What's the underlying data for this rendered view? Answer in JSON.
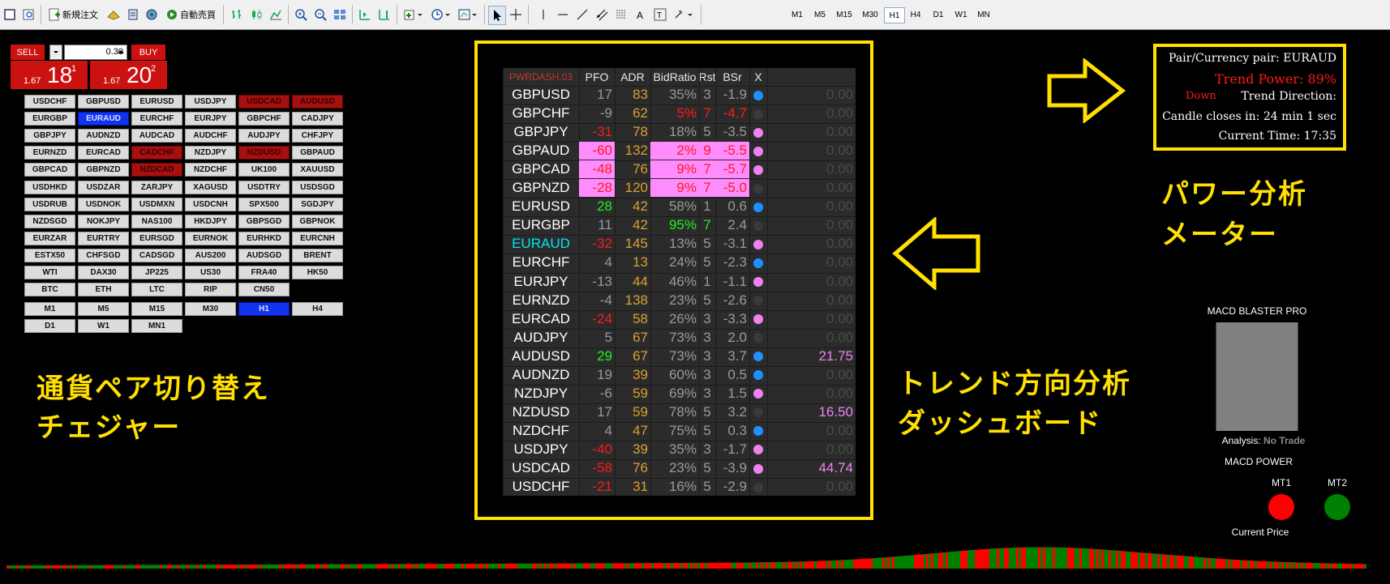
{
  "toolbar": {
    "new_order": "新規注文",
    "auto_trade": "自動売買",
    "timeframes": [
      "M1",
      "M5",
      "M15",
      "M30",
      "H1",
      "H4",
      "D1",
      "W1",
      "MN"
    ],
    "selected_timeframe": "H1"
  },
  "trade_panel": {
    "sell_label": "SELL",
    "buy_label": "BUY",
    "lot_value": "0.30",
    "sell_price": {
      "prefix": "1.67",
      "big": "18",
      "sup": "1"
    },
    "buy_price": {
      "prefix": "1.67",
      "big": "20",
      "sup": "2"
    }
  },
  "pair_switcher": {
    "pairs": [
      [
        "USDCHF",
        "GBPUSD",
        "EURUSD",
        "USDJPY",
        "USDCAD",
        "AUDUSD"
      ],
      [
        "EURGBP",
        "EURAUD",
        "EURCHF",
        "EURJPY",
        "GBPCHF",
        "CADJPY"
      ],
      [
        "GBPJPY",
        "AUDNZD",
        "AUDCAD",
        "AUDCHF",
        "AUDJPY",
        "CHFJPY"
      ],
      [
        "EURNZD",
        "EURCAD",
        "CADCHF",
        "NZDJPY",
        "NZDUSD",
        "GBPAUD"
      ],
      [
        "GBPCAD",
        "GBPNZD",
        "NZDCAD",
        "NZDCHF",
        "UK100",
        "XAUUSD"
      ],
      [
        "USDHKD",
        "USDZAR",
        "ZARJPY",
        "XAGUSD",
        "USDTRY",
        "USDSGD"
      ],
      [
        "USDRUB",
        "USDNOK",
        "USDMXN",
        "USDCNH",
        "SPX500",
        "SGDJPY"
      ],
      [
        "NZDSGD",
        "NOKJPY",
        "NAS100",
        "HKDJPY",
        "GBPSGD",
        "GBPNOK"
      ],
      [
        "EURZAR",
        "EURTRY",
        "EURSGD",
        "EURNOK",
        "EURHKD",
        "EURCNH"
      ],
      [
        "ESTX50",
        "CHFSGD",
        "CADSGD",
        "AUS200",
        "AUDSGD",
        "BRENT"
      ],
      [
        "WTI",
        "DAX30",
        "JP225",
        "US30",
        "FRA40",
        "HK50"
      ],
      [
        "BTC",
        "ETH",
        "LTC",
        "RIP",
        "CN50"
      ]
    ],
    "highlight_red": [
      "USDCAD",
      "AUDUSD",
      "CADCHF",
      "NZDUSD",
      "NZDCAD"
    ],
    "selected_pair": "EURAUD",
    "timeframes": [
      [
        "M1",
        "M5",
        "M15",
        "M30",
        "H1",
        "H4"
      ],
      [
        "D1",
        "W1",
        "MN1"
      ]
    ],
    "selected_timeframe": "H1"
  },
  "labels": {
    "switcher_line1": "通貨ペア切り替え",
    "switcher_line2": "チェジャー",
    "dashboard_line1": "トレンド方向分析",
    "dashboard_line2": "ダッシュボード",
    "meter_line1": "パワー分析",
    "meter_line2": "メーター"
  },
  "dashboard": {
    "headers": [
      "PWRDASH.03",
      "PFO",
      "ADR",
      "BidRatio",
      "Rst",
      "BSr",
      "X"
    ],
    "rows": [
      {
        "pair": "GBPUSD",
        "pfo": "17",
        "adr": "83",
        "bid": "35%",
        "rst": "3",
        "bsr": "-1.9",
        "dot": "blue",
        "val": "0.00"
      },
      {
        "pair": "GBPCHF",
        "pfo": "-9",
        "adr": "62",
        "bid": "5%",
        "rst": "7",
        "bsr": "-4.7",
        "dot": "gray",
        "val": "0.00"
      },
      {
        "pair": "GBPJPY",
        "pfo": "-31",
        "adr": "78",
        "bid": "18%",
        "rst": "5",
        "bsr": "-3.5",
        "dot": "pink",
        "val": "0.00"
      },
      {
        "pair": "GBPAUD",
        "pfo": "-60",
        "adr": "132",
        "bid": "2%",
        "rst": "9",
        "bsr": "-5.5",
        "dot": "pink",
        "val": "0.00"
      },
      {
        "pair": "GBPCAD",
        "pfo": "-48",
        "adr": "76",
        "bid": "9%",
        "rst": "7",
        "bsr": "-5.7",
        "dot": "pink",
        "val": "0.00"
      },
      {
        "pair": "GBPNZD",
        "pfo": "-28",
        "adr": "120",
        "bid": "9%",
        "rst": "7",
        "bsr": "-5.0",
        "dot": "gray",
        "val": "0.00"
      },
      {
        "pair": "EURUSD",
        "pfo": "28",
        "adr": "42",
        "bid": "58%",
        "rst": "1",
        "bsr": "0.6",
        "dot": "blue",
        "val": "0.00"
      },
      {
        "pair": "EURGBP",
        "pfo": "11",
        "adr": "42",
        "bid": "95%",
        "rst": "7",
        "bsr": "2.4",
        "dot": "gray",
        "val": "0.00"
      },
      {
        "pair": "EURAUD",
        "pfo": "-32",
        "adr": "145",
        "bid": "13%",
        "rst": "5",
        "bsr": "-3.1",
        "dot": "pink",
        "val": "0.00"
      },
      {
        "pair": "EURCHF",
        "pfo": "4",
        "adr": "13",
        "bid": "24%",
        "rst": "5",
        "bsr": "-2.3",
        "dot": "blue",
        "val": "0.00"
      },
      {
        "pair": "EURJPY",
        "pfo": "-13",
        "adr": "44",
        "bid": "46%",
        "rst": "1",
        "bsr": "-1.1",
        "dot": "pink",
        "val": "0.00"
      },
      {
        "pair": "EURNZD",
        "pfo": "-4",
        "adr": "138",
        "bid": "23%",
        "rst": "5",
        "bsr": "-2.6",
        "dot": "gray",
        "val": "0.00"
      },
      {
        "pair": "EURCAD",
        "pfo": "-24",
        "adr": "58",
        "bid": "26%",
        "rst": "3",
        "bsr": "-3.3",
        "dot": "pink",
        "val": "0.00"
      },
      {
        "pair": "AUDJPY",
        "pfo": "5",
        "adr": "67",
        "bid": "73%",
        "rst": "3",
        "bsr": "2.0",
        "dot": "gray",
        "val": "0.00"
      },
      {
        "pair": "AUDUSD",
        "pfo": "29",
        "adr": "67",
        "bid": "73%",
        "rst": "3",
        "bsr": "3.7",
        "dot": "blue",
        "val": "21.75"
      },
      {
        "pair": "AUDNZD",
        "pfo": "19",
        "adr": "39",
        "bid": "60%",
        "rst": "3",
        "bsr": "0.5",
        "dot": "blue",
        "val": "0.00"
      },
      {
        "pair": "NZDJPY",
        "pfo": "-6",
        "adr": "59",
        "bid": "69%",
        "rst": "3",
        "bsr": "1.5",
        "dot": "pink",
        "val": "0.00"
      },
      {
        "pair": "NZDUSD",
        "pfo": "17",
        "adr": "59",
        "bid": "78%",
        "rst": "5",
        "bsr": "3.2",
        "dot": "gray",
        "val": "16.50"
      },
      {
        "pair": "NZDCHF",
        "pfo": "4",
        "adr": "47",
        "bid": "75%",
        "rst": "5",
        "bsr": "0.3",
        "dot": "blue",
        "val": "0.00"
      },
      {
        "pair": "USDJPY",
        "pfo": "-40",
        "adr": "39",
        "bid": "35%",
        "rst": "3",
        "bsr": "-1.7",
        "dot": "pink",
        "val": "0.00"
      },
      {
        "pair": "USDCAD",
        "pfo": "-58",
        "adr": "76",
        "bid": "23%",
        "rst": "5",
        "bsr": "-3.9",
        "dot": "pink",
        "val": "44.74"
      },
      {
        "pair": "USDCHF",
        "pfo": "-21",
        "adr": "31",
        "bid": "16%",
        "rst": "5",
        "bsr": "-2.9",
        "dot": "gray",
        "val": "0.00"
      }
    ],
    "pink_rows": [
      "GBPAUD",
      "GBPCAD",
      "GBPNZD"
    ],
    "active_pair": "EURAUD"
  },
  "power_meter": {
    "pair_line": "Pair/Currency pair: EURAUD",
    "trend_power": "Trend Power: 89%",
    "trend_direction_label": "Trend Direction:",
    "trend_direction_value": "Down",
    "candle_closes": "Candle closes in: 24 min 1 sec",
    "current_time": "Current Time: 17:35"
  },
  "macd": {
    "title": "MACD BLASTER PRO",
    "analysis_label": "Analysis:",
    "analysis_value": "No Trade",
    "power_label": "MACD POWER",
    "mt1_label": "MT1",
    "mt2_label": "MT2",
    "current_price_label": "Current Price",
    "mt1_color": "#ff0000",
    "mt2_color": "#008000"
  },
  "colors": {
    "highlight": "#ffe000",
    "bull": "#008000",
    "bear": "#ff0000"
  }
}
